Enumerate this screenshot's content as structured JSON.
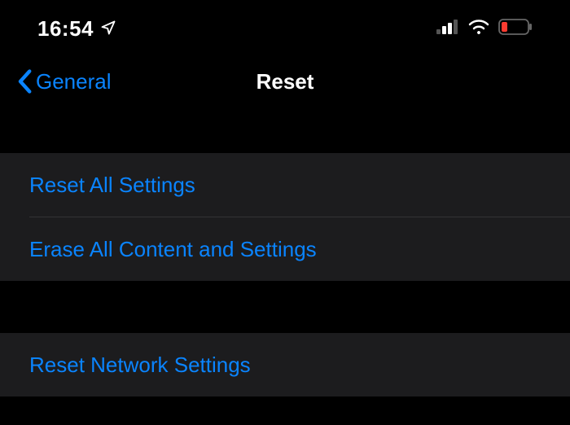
{
  "statusBar": {
    "time": "16:54"
  },
  "nav": {
    "backLabel": "General",
    "title": "Reset"
  },
  "section1": {
    "rows": [
      {
        "label": "Reset All Settings"
      },
      {
        "label": "Erase All Content and Settings"
      }
    ]
  },
  "section2": {
    "rows": [
      {
        "label": "Reset Network Settings"
      }
    ]
  },
  "colors": {
    "accent": "#0a84ff",
    "background": "#000000",
    "rowBackground": "#1c1c1e",
    "batteryLow": "#ff3b30"
  }
}
